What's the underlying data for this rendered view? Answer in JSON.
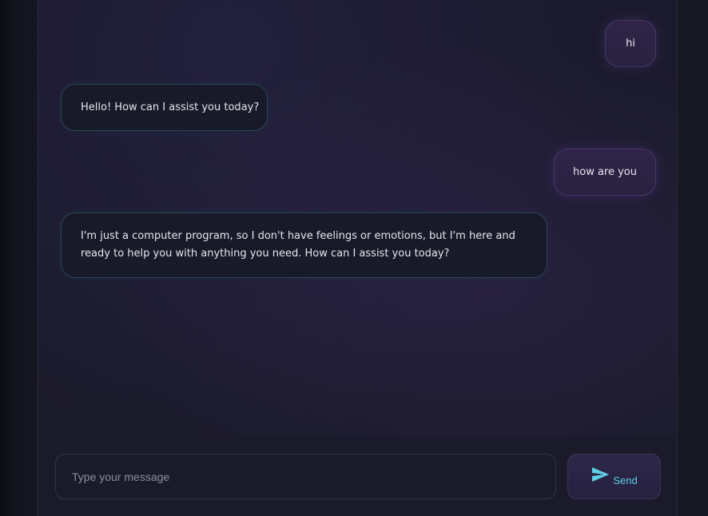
{
  "messages": [
    {
      "role": "user",
      "text": "hi"
    },
    {
      "role": "assistant",
      "text": "Hello! How can I assist you today?"
    },
    {
      "role": "user",
      "text": "how are you"
    },
    {
      "role": "assistant",
      "text": "I'm just a computer program, so I don't have feelings or emotions, but I'm here and ready to help you with anything you need. How can I assist you today?"
    }
  ],
  "composer": {
    "placeholder": "Type your message",
    "value": "",
    "send_label": "Send",
    "send_icon": "paper-plane-icon"
  },
  "colors": {
    "accent": "#5fd0e6",
    "user_bubble": "#2f2447",
    "assistant_bubble": "#181a29"
  }
}
